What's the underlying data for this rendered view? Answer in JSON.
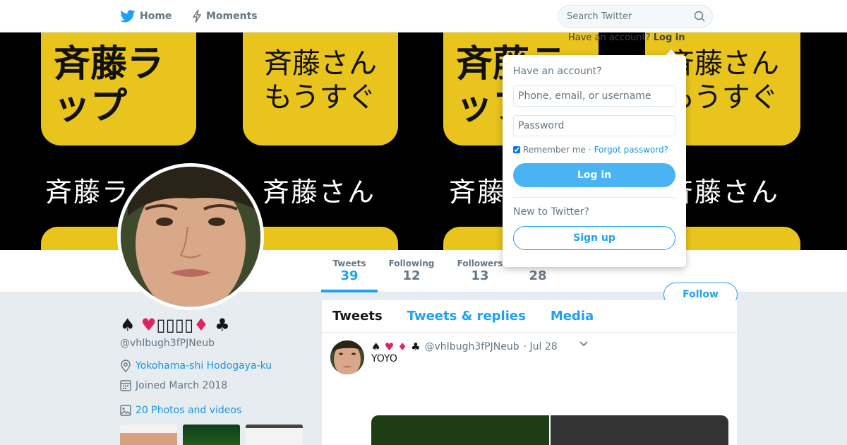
{
  "topnav": {
    "home_label": "Home",
    "moments_label": "Moments",
    "search_placeholder": "Search Twitter"
  },
  "banner": {
    "tile1_text": "斉藤ラップ",
    "tile2_text": "斉藤さん もうすぐ",
    "label1": "斉藤ラ",
    "label2": "斉藤さん",
    "label3": "斉藤",
    "label4": "斉藤さん",
    "prompt_text": "Have an account?",
    "prompt_link": "Log in"
  },
  "profile_nav": {
    "stats": [
      {
        "label": "Tweets",
        "value": "39"
      },
      {
        "label": "Following",
        "value": "12"
      },
      {
        "label": "Followers",
        "value": "13"
      },
      {
        "label": "",
        "value": "28"
      }
    ],
    "follow_label": "Follow"
  },
  "profile": {
    "name_spade": "♠",
    "name_heart": "♥",
    "name_boxes": "▯▯▯▯",
    "name_diamond": "♦",
    "name_club": "♣",
    "handle": "@vhIbugh3fPJNeub",
    "location": "Yokohama-shi Hodogaya-ku",
    "joined": "Joined March 2018",
    "photos_link": "20 Photos and videos"
  },
  "timeline": {
    "tabs": [
      "Tweets",
      "Tweets & replies",
      "Media"
    ],
    "tweet": {
      "name_spade": "♠",
      "name_heart": "♥",
      "name_diamond": "♦",
      "name_club": "♣",
      "handle": "@vhIbugh3fPJNeub",
      "date": "· Jul 28",
      "text": "YOYO"
    }
  },
  "login_dropdown": {
    "title": "Have an account?",
    "username_placeholder": "Phone, email, or username",
    "password_placeholder": "Password",
    "remember_label": "Remember me",
    "separator": "·",
    "forgot_label": "Forgot password?",
    "login_label": "Log in",
    "new_label": "New to Twitter?",
    "signup_label": "Sign up"
  },
  "colors": {
    "accent": "#1da1f2",
    "banner_tile": "#e9c41c",
    "heart_red": "#e0245e"
  }
}
